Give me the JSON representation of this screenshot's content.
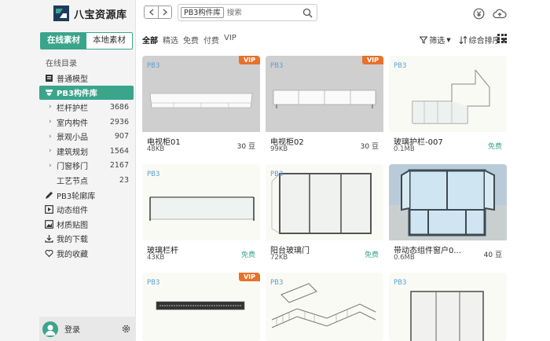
{
  "app": {
    "title": "八宝资源库"
  },
  "source_tabs": [
    {
      "label": "在线素材",
      "active": true
    },
    {
      "label": "本地素材",
      "active": false
    }
  ],
  "nav": {
    "heading": "在线目录",
    "items": [
      {
        "label": "普通模型",
        "icon": "book-icon"
      },
      {
        "label": "PB3构件库",
        "icon": "layers-icon",
        "active": true
      },
      {
        "label": "栏杆护栏",
        "count": "3686"
      },
      {
        "label": "室内构件",
        "count": "2936"
      },
      {
        "label": "景观小品",
        "count": "907"
      },
      {
        "label": "建筑规划",
        "count": "1564"
      },
      {
        "label": "门窗移门",
        "count": "2167"
      },
      {
        "label": "工艺节点",
        "count": "23"
      },
      {
        "label": "PB3轮廓库",
        "icon": "pencil-icon"
      },
      {
        "label": "动态组件",
        "icon": "play-icon"
      },
      {
        "label": "材质贴图",
        "icon": "image-icon"
      },
      {
        "label": "我的下载",
        "icon": "download-icon"
      },
      {
        "label": "我的收藏",
        "icon": "heart-icon"
      }
    ]
  },
  "footer": {
    "login_label": "登录"
  },
  "search": {
    "chip": "PB3构件库",
    "placeholder": "搜索"
  },
  "filters": [
    {
      "label": "全部",
      "active": true
    },
    {
      "label": "精选"
    },
    {
      "label": "免费"
    },
    {
      "label": "付费"
    },
    {
      "label": "VIP"
    }
  ],
  "tools": {
    "filter_label": "筛选",
    "sort_label": "综合排序"
  },
  "colors": {
    "accent": "#3ba58b",
    "vip": "#e8712b",
    "brand": "#5a9fd0"
  },
  "cards": [
    {
      "brand": "PB3",
      "vip": "VIP",
      "name": "电视柜01",
      "size": "48KB",
      "price": "30 豆"
    },
    {
      "brand": "PB3",
      "vip": "VIP",
      "name": "电视柜02",
      "size": "99KB",
      "price": "30 豆"
    },
    {
      "brand": "PB3",
      "name": "玻璃护栏-007",
      "size": "0.1MB",
      "price": "免费",
      "free": true
    },
    {
      "brand": "PB3",
      "name": "玻璃栏杆",
      "size": "43KB",
      "price": "免费",
      "free": true
    },
    {
      "brand": "PB3",
      "name": "阳台玻璃门",
      "size": "72KB",
      "price": "免费",
      "free": true
    },
    {
      "name": "带动态组件窗户0...",
      "size": "0.6MB",
      "price": "40 豆"
    },
    {
      "brand": "PB3",
      "vip": "VIP"
    },
    {
      "brand": "PB3"
    },
    {
      "brand": "PB3"
    }
  ]
}
